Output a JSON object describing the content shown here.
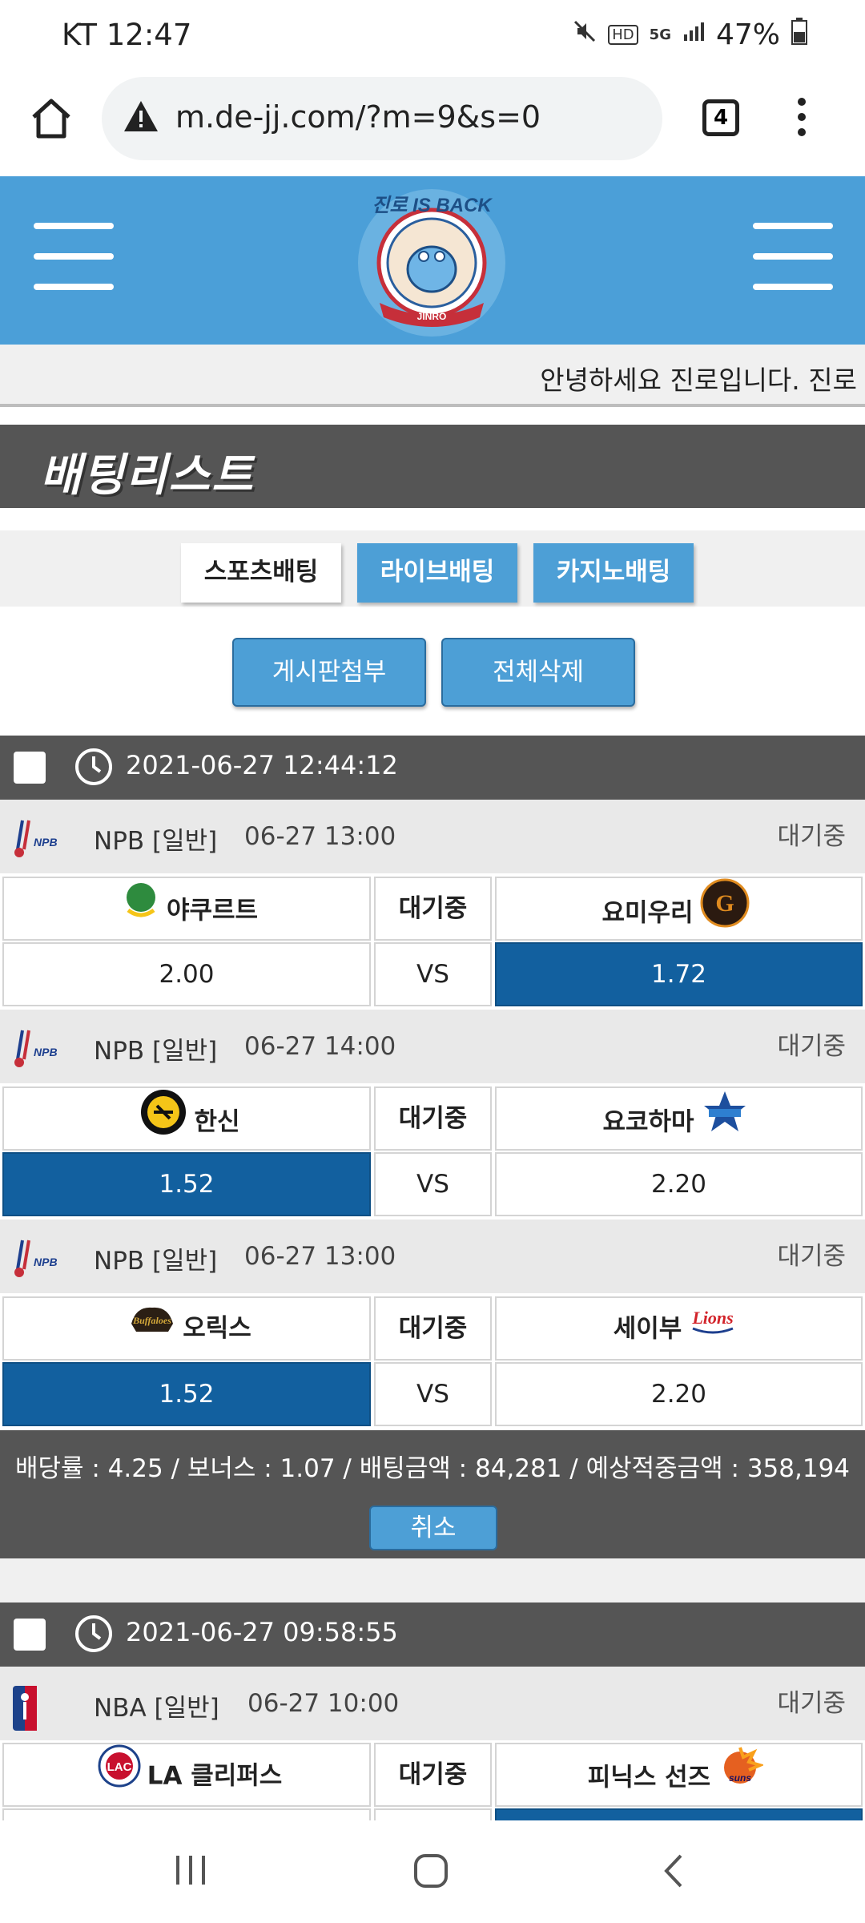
{
  "status_bar": {
    "carrier_time": "KT 12:47",
    "battery": "47%",
    "hd": "HD",
    "net": "5G"
  },
  "browser": {
    "url": "m.de-jj.com/?m=9&s=0",
    "tab_count": "4"
  },
  "header": {
    "logo_alt": "JINRO IS BACK",
    "marquee": "안녕하세요 진로입니다. 진로"
  },
  "section_title": "배팅리스트",
  "tabs": [
    {
      "label": "스포츠배팅",
      "active": true
    },
    {
      "label": "라이브배팅",
      "active": false
    },
    {
      "label": "카지노배팅",
      "active": false
    }
  ],
  "actions": {
    "attach": "게시판첨부",
    "delete_all": "전체삭제"
  },
  "bets": [
    {
      "time": "2021-06-27 12:44:12",
      "matches": [
        {
          "league": "NPB [일반]",
          "kickoff": "06-27 13:00",
          "status": "대기중",
          "home": "야쿠르트",
          "mid_status": "대기중",
          "away": "요미우리",
          "home_odds": "2.00",
          "vs": "VS",
          "away_odds": "1.72",
          "selected": "away"
        },
        {
          "league": "NPB [일반]",
          "kickoff": "06-27 14:00",
          "status": "대기중",
          "home": "한신",
          "mid_status": "대기중",
          "away": "요코하마",
          "home_odds": "1.52",
          "vs": "VS",
          "away_odds": "2.20",
          "selected": "home"
        },
        {
          "league": "NPB [일반]",
          "kickoff": "06-27 13:00",
          "status": "대기중",
          "home": "오릭스",
          "mid_status": "대기중",
          "away": "세이부",
          "home_odds": "1.52",
          "vs": "VS",
          "away_odds": "2.20",
          "selected": "home"
        }
      ],
      "summary": "배당률 : 4.25 / 보너스 : 1.07 / 배팅금액 : 84,281 / 예상적중금액 : 358,194",
      "cancel": "취소"
    },
    {
      "time": "2021-06-27 09:58:55",
      "matches": [
        {
          "league": "NBA [일반]",
          "kickoff": "06-27 10:00",
          "status": "대기중",
          "home": "LA 클리퍼스",
          "mid_status": "대기중",
          "away": "피닉스 선즈"
        }
      ]
    }
  ],
  "colors": {
    "header_blue": "#4b9fd8",
    "dark_gray": "#555555",
    "selected_blue": "#12609f"
  }
}
